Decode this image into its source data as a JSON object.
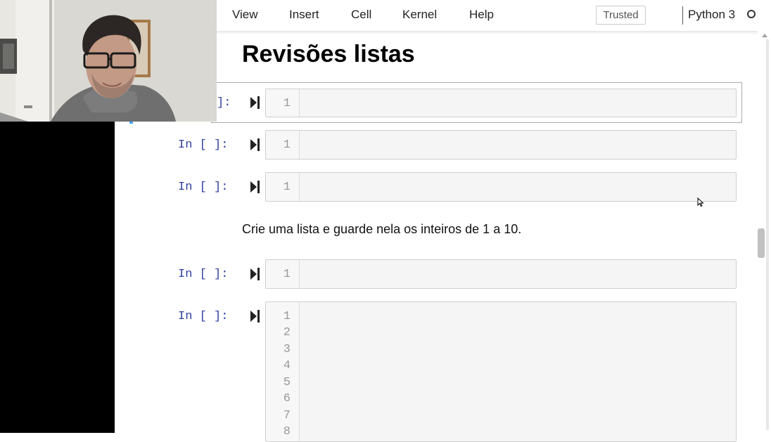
{
  "menu": {
    "items": [
      "View",
      "Insert",
      "Cell",
      "Kernel",
      "Help"
    ],
    "trusted_label": "Trusted",
    "kernel_name": "Python 3"
  },
  "notebook": {
    "heading": "Revisões listas",
    "cells": [
      {
        "prompt": "]:",
        "line_numbers": [
          "1"
        ]
      },
      {
        "prompt": "In [ ]:",
        "line_numbers": [
          "1"
        ]
      },
      {
        "prompt": "In [ ]:",
        "line_numbers": [
          "1"
        ]
      },
      {
        "prompt": "In [ ]:",
        "line_numbers": [
          "1"
        ]
      },
      {
        "prompt": "In [ ]:",
        "line_numbers": [
          "1",
          "2",
          "3",
          "4",
          "5",
          "6",
          "7",
          "8"
        ]
      }
    ],
    "markdown_text": "Crie uma lista e guarde nela os inteiros de 1 a 10."
  },
  "icons": {
    "run": "run-cell-icon",
    "kernel_status": "kernel-idle-icon"
  }
}
